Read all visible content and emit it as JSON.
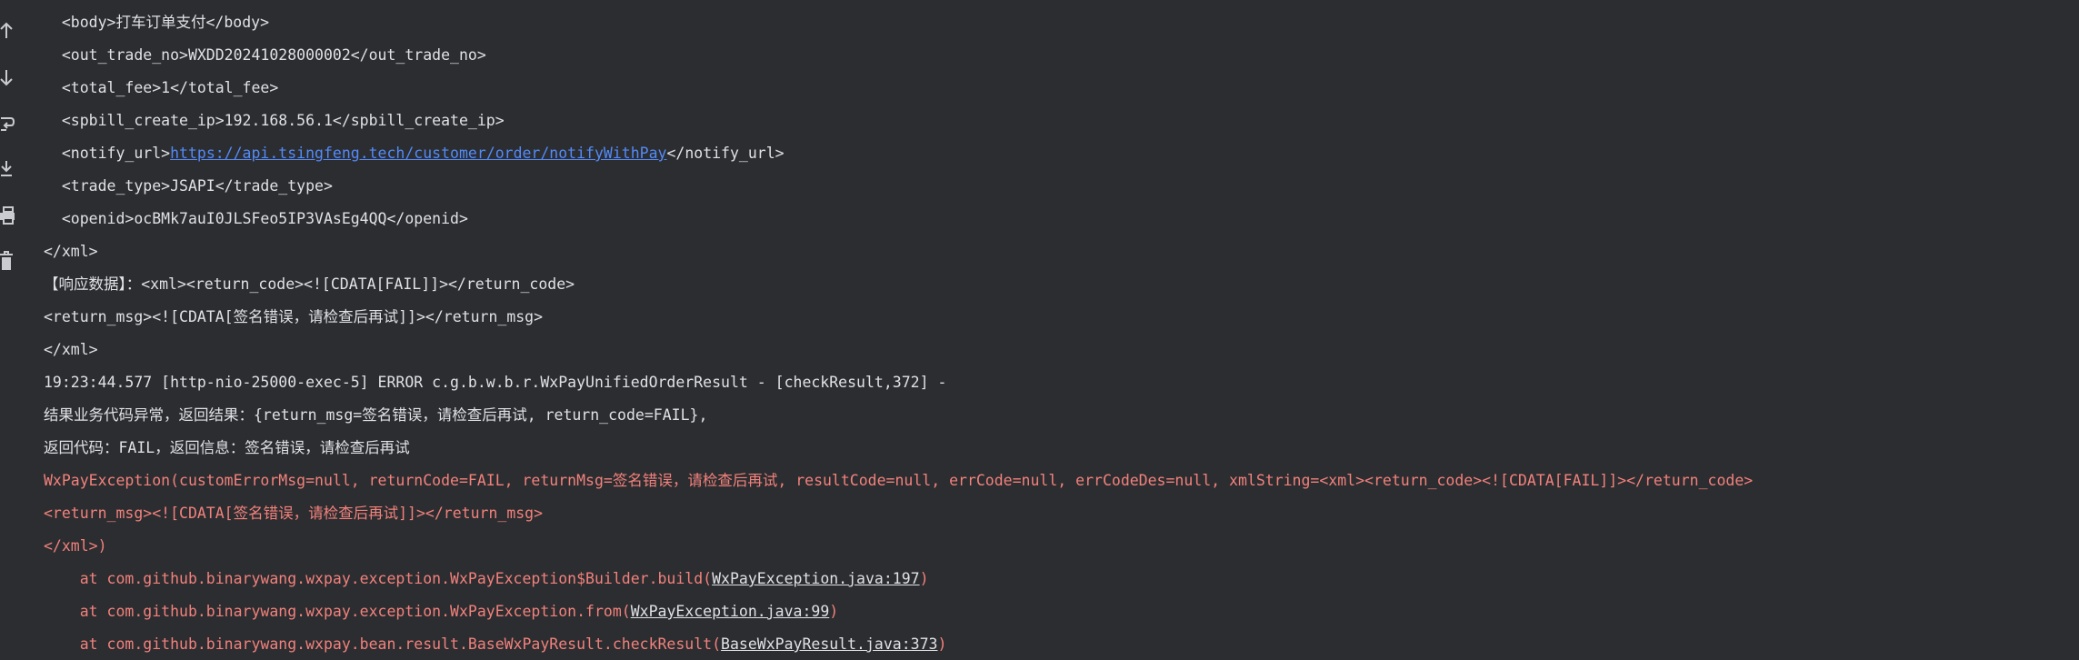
{
  "gutter": {
    "buttons": [
      {
        "name": "scroll-up-icon",
        "icon": "arrow-up"
      },
      {
        "name": "scroll-down-icon",
        "icon": "arrow-down"
      },
      {
        "name": "soft-wrap-icon",
        "icon": "wrap"
      },
      {
        "name": "scroll-to-end-icon",
        "icon": "scroll-end"
      },
      {
        "name": "print-icon",
        "icon": "printer"
      },
      {
        "name": "clear-all-icon",
        "icon": "trash"
      }
    ]
  },
  "console": {
    "line1": "  <body>打车订单支付</body>",
    "line2": "  <out_trade_no>WXDD20241028000002</out_trade_no>",
    "line3": "  <total_fee>1</total_fee>",
    "line4": "  <spbill_create_ip>192.168.56.1</spbill_create_ip>",
    "line5_prefix": "  <notify_url>",
    "line5_link": "https://api.tsingfeng.tech/customer/order/notifyWithPay",
    "line5_suffix": "</notify_url>",
    "line6": "  <trade_type>JSAPI</trade_type>",
    "line7": "  <openid>ocBMk7auI0JLSFeo5IP3VAsEg4QQ</openid>",
    "line8": "</xml>",
    "line9": "【响应数据】：<xml><return_code><![CDATA[FAIL]]></return_code>",
    "line10": "<return_msg><![CDATA[签名错误，请检查后再试]]></return_msg>",
    "line11": "</xml>",
    "line12": "19:23:44.577 [http-nio-25000-exec-5] ERROR c.g.b.w.b.r.WxPayUnifiedOrderResult - [checkResult,372] -",
    "line13": "结果业务代码异常，返回结果：{return_msg=签名错误，请检查后再试, return_code=FAIL},",
    "line14": "返回代码：FAIL，返回信息：签名错误，请检查后再试",
    "line15": "WxPayException(customErrorMsg=null, returnCode=FAIL, returnMsg=签名错误，请检查后再试, resultCode=null, errCode=null, errCodeDes=null, xmlString=<xml><return_code><![CDATA[FAIL]]></return_code>",
    "line16": "<return_msg><![CDATA[签名错误，请检查后再试]]></return_msg>",
    "line17": "</xml>)",
    "trace1_prefix": "    at com.github.binarywang.wxpay.exception.WxPayException$Builder.build(",
    "trace1_link": "WxPayException.java:197",
    "trace1_suffix": ")",
    "trace2_prefix": "    at com.github.binarywang.wxpay.exception.WxPayException.from(",
    "trace2_link": "WxPayException.java:99",
    "trace2_suffix": ")",
    "trace3_prefix": "    at com.github.binarywang.wxpay.bean.result.BaseWxPayResult.checkResult(",
    "trace3_link": "BaseWxPayResult.java:373",
    "trace3_suffix": ")"
  },
  "colors": {
    "background": "#2b2d30",
    "text": "#dfe1e5",
    "error_text": "#f2817c",
    "link": "#548af7"
  }
}
